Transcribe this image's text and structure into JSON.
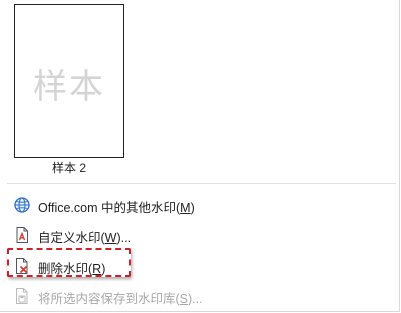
{
  "gallery": {
    "thumbnail": {
      "watermark_text": "样本",
      "caption": "样本 2"
    }
  },
  "menu_items": [
    {
      "label": "Office.com 中的其他水印(",
      "mnemonic": "M",
      "suffix": ")",
      "icon": "globe-icon",
      "enabled": true
    },
    {
      "label": "自定义水印(",
      "mnemonic": "W",
      "suffix": ")...",
      "icon": "custom-watermark-icon",
      "enabled": true
    },
    {
      "label": "删除水印(",
      "mnemonic": "R",
      "suffix": ")",
      "icon": "remove-watermark-icon",
      "enabled": true,
      "highlighted": true
    },
    {
      "label": "将所选内容保存到水印库(",
      "mnemonic": "S",
      "suffix": ")...",
      "icon": "save-to-gallery-icon",
      "enabled": false
    }
  ],
  "colors": {
    "highlight_border": "#d0202a",
    "globe_blue": "#2b6cc4",
    "document_red": "#d9342b",
    "disabled_text": "#a8a8a8"
  }
}
